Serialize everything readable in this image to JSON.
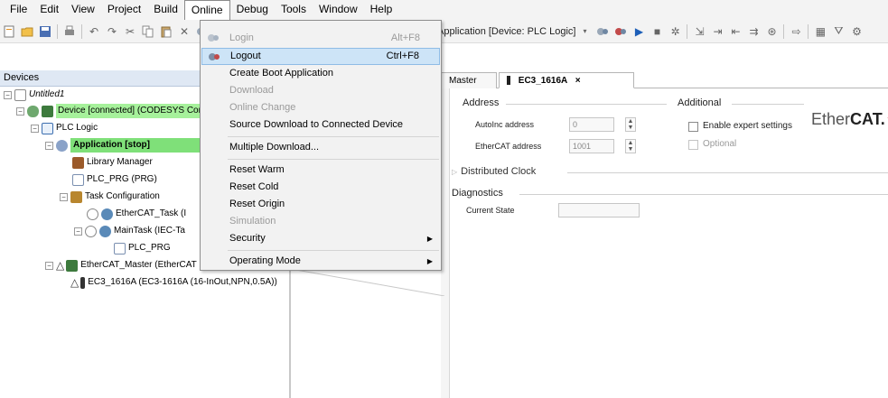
{
  "menubar": [
    "File",
    "Edit",
    "View",
    "Project",
    "Build",
    "Online",
    "Debug",
    "Tools",
    "Window",
    "Help"
  ],
  "toolbar": {
    "application_label": "Application [Device: PLC Logic]"
  },
  "devices_panel": {
    "title": "Devices",
    "tree": [
      {
        "label": "Untitled1"
      },
      {
        "label": "Device [connected] (CODESYS Cor"
      },
      {
        "label": "PLC Logic"
      },
      {
        "label": "Application [stop]"
      },
      {
        "label": "Library Manager"
      },
      {
        "label": "PLC_PRG (PRG)"
      },
      {
        "label": "Task Configuration"
      },
      {
        "label": "EtherCAT_Task (I"
      },
      {
        "label": "MainTask (IEC-Ta"
      },
      {
        "label": "PLC_PRG"
      },
      {
        "label": "EtherCAT_Master (EtherCAT M"
      },
      {
        "label": "EC3_1616A (EC3-1616A (16-InOut,NPN,0.5A))"
      }
    ]
  },
  "online_menu": {
    "items": [
      {
        "label": "Login",
        "shortcut": "Alt+F8"
      },
      {
        "label": "Logout",
        "shortcut": "Ctrl+F8"
      },
      {
        "label": "Create Boot Application",
        "shortcut": ""
      },
      {
        "label": "Download",
        "shortcut": ""
      },
      {
        "label": "Online Change",
        "shortcut": ""
      },
      {
        "label": "Source Download to Connected Device",
        "shortcut": ""
      },
      {
        "label": "Multiple Download...",
        "shortcut": ""
      },
      {
        "label": "Reset Warm",
        "shortcut": ""
      },
      {
        "label": "Reset Cold",
        "shortcut": ""
      },
      {
        "label": "Reset Origin",
        "shortcut": ""
      },
      {
        "label": "Simulation",
        "shortcut": ""
      },
      {
        "label": "Security",
        "shortcut": ""
      },
      {
        "label": "Operating Mode",
        "shortcut": ""
      }
    ]
  },
  "editor": {
    "tabs": [
      {
        "label": "Master"
      },
      {
        "label": "EC3_1616A",
        "close": "×"
      }
    ],
    "address": {
      "title": "Address",
      "autoinc_label": "AutoInc address",
      "autoinc_value": "0",
      "ethercat_label": "EtherCAT address",
      "ethercat_value": "1001"
    },
    "additional": {
      "title": "Additional",
      "expert": "Enable expert settings",
      "optional": "Optional"
    },
    "distributed_clock": "Distributed Clock",
    "diagnostics": {
      "title": "Diagnostics",
      "current_state_label": "Current State"
    },
    "logo_text_plain": "Ether",
    "logo_text_bold": "CAT."
  }
}
